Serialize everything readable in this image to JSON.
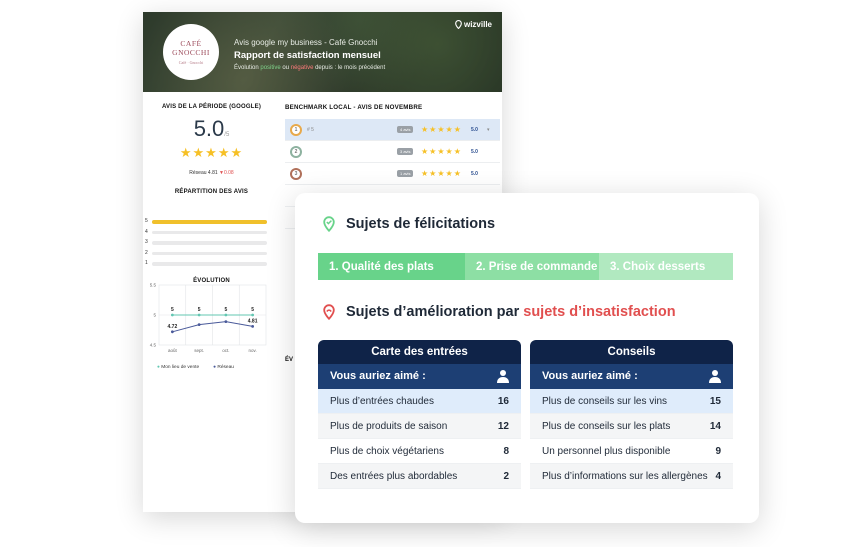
{
  "report": {
    "brand": "wizville",
    "logo": {
      "line1": "CAFÉ",
      "line2": "GNOCCHI",
      "line3": "Café · Gnocchi"
    },
    "header": {
      "subtitle": "Avis google my business - Café Gnocchi",
      "title": "Rapport de satisfaction mensuel",
      "evo_prefix": "Évolution",
      "evo_positive": "positive",
      "evo_or": "ou",
      "evo_negative": "négative",
      "evo_suffix": "depuis : le mois précédent"
    },
    "period": {
      "title": "AVIS DE LA PÉRIODE (GOOGLE)",
      "score": "5.0",
      "score_unit": "/5",
      "network_label": "Réseau",
      "network_value": "4.81",
      "network_delta": "▼0.08"
    },
    "distribution": {
      "title": "RÉPARTITION DES AVIS",
      "rows": [
        {
          "label": "5",
          "fraction": 1.0
        },
        {
          "label": "4",
          "fraction": 0.0
        },
        {
          "label": "3",
          "fraction": 0.0
        },
        {
          "label": "2",
          "fraction": 0.0
        },
        {
          "label": "1",
          "fraction": 0.0
        }
      ]
    },
    "benchmark": {
      "title": "BENCHMARK LOCAL - AVIS DE NOVEMBRE",
      "rows": [
        {
          "rank": "1",
          "name": "# 5",
          "badge": "4 avis",
          "score": "5.0",
          "medal": "#e8a94a",
          "active": true,
          "chevron": "▾"
        },
        {
          "rank": "2",
          "name": "",
          "badge": "3 avis",
          "score": "5.0",
          "medal": "#8eb2a0",
          "active": false,
          "chevron": ""
        },
        {
          "rank": "3",
          "name": "",
          "badge": "1 avis",
          "score": "5.0",
          "medal": "#b0705a",
          "active": false,
          "chevron": ""
        }
      ],
      "ev_label": "ÉV"
    },
    "chart_data": {
      "type": "line",
      "title": "ÉVOLUTION",
      "categories": [
        "août",
        "sept.",
        "oct.",
        "nov."
      ],
      "ylim": [
        4.5,
        5.5
      ],
      "yticks": [
        "5.5",
        "5",
        "4.5"
      ],
      "grid": true,
      "legend": "bottom",
      "series": [
        {
          "name": "Mon lieu de vente",
          "color": "#63c7b2",
          "values": [
            5,
            5,
            5,
            5
          ],
          "labels": [
            "5",
            "5",
            "5",
            "5"
          ]
        },
        {
          "name": "Réseau",
          "color": "#4a5a9a",
          "values": [
            4.72,
            4.84,
            4.89,
            4.81
          ],
          "labels": [
            "4.72",
            "",
            "",
            "4.81"
          ]
        }
      ]
    }
  },
  "front": {
    "felicitations_title": "Sujets de félicitations",
    "tabs": [
      {
        "label": "1.   Qualité des plats"
      },
      {
        "label": "2.   Prise de commande"
      },
      {
        "label": "3.   Choix desserts"
      }
    ],
    "amelioration_prefix": "Sujets d’amélioration par ",
    "amelioration_highlight": "sujets d’insatisfaction",
    "tables": [
      {
        "header": "Carte des entrées",
        "sub": "Vous auriez aimé :",
        "rows": [
          {
            "label": "Plus d’entrées chaudes",
            "value": "16"
          },
          {
            "label": "Plus de produits de saison",
            "value": "12"
          },
          {
            "label": "Plus de choix végétariens",
            "value": "8"
          },
          {
            "label": "Des entrées plus abordables",
            "value": "2"
          }
        ]
      },
      {
        "header": "Conseils",
        "sub": "Vous auriez aimé :",
        "rows": [
          {
            "label": "Plus de conseils sur les vins",
            "value": "15"
          },
          {
            "label": "Plus de conseils sur les plats",
            "value": "14"
          },
          {
            "label": "Un personnel plus disponible",
            "value": "9"
          },
          {
            "label": "Plus d’informations sur les allergènes",
            "value": "4"
          }
        ]
      }
    ],
    "colors": {
      "green": "#68d38a",
      "navy": "#0f2348",
      "red": "#e14f4f"
    }
  }
}
